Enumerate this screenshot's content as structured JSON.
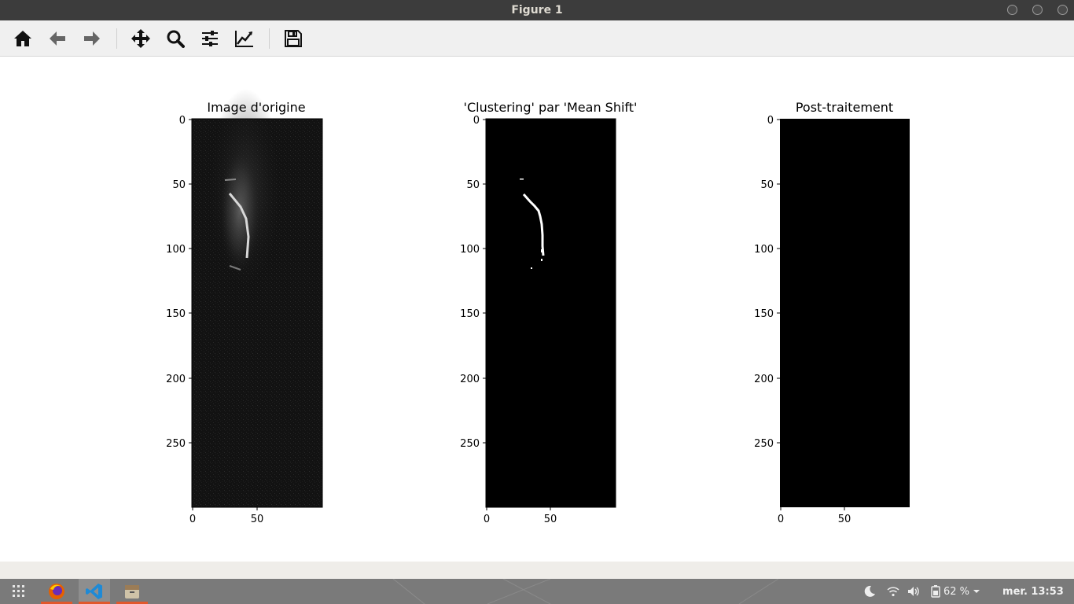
{
  "window": {
    "title": "Figure 1"
  },
  "toolbar": {
    "buttons": [
      {
        "name": "home-button",
        "icon": "home-icon"
      },
      {
        "name": "back-button",
        "icon": "arrow-left-icon"
      },
      {
        "name": "forward-button",
        "icon": "arrow-right-icon"
      },
      {
        "name": "pan-button",
        "icon": "move-icon"
      },
      {
        "name": "zoom-button",
        "icon": "magnifier-icon"
      },
      {
        "name": "configure-subplots-button",
        "icon": "sliders-icon"
      },
      {
        "name": "edit-axes-button",
        "icon": "line-chart-icon"
      },
      {
        "name": "save-button",
        "icon": "floppy-disk-icon"
      }
    ]
  },
  "figure": {
    "panels": [
      {
        "title": "Image d'origine",
        "content": "ultrasound-image"
      },
      {
        "title": "'Clustering' par 'Mean Shift'",
        "content": "binary-mask"
      },
      {
        "title": "Post-traitement",
        "content": "empty-mask"
      }
    ],
    "y_ticks": [
      "0",
      "50",
      "100",
      "150",
      "200",
      "250"
    ],
    "x_ticks": [
      "0",
      "50"
    ]
  },
  "chart_data": [
    {
      "type": "heatmap",
      "title": "Image d'origine",
      "xlim": [
        0,
        100
      ],
      "ylim": [
        300,
        0
      ],
      "xticks": [
        0,
        50
      ],
      "yticks": [
        0,
        50,
        100,
        150,
        200,
        250
      ],
      "colormap": "gray"
    },
    {
      "type": "heatmap",
      "title": "'Clustering' par 'Mean Shift'",
      "xlim": [
        0,
        100
      ],
      "ylim": [
        300,
        0
      ],
      "xticks": [
        0,
        50
      ],
      "yticks": [
        0,
        50,
        100,
        150,
        200,
        250
      ],
      "colormap": "gray"
    },
    {
      "type": "heatmap",
      "title": "Post-traitement",
      "xlim": [
        0,
        100
      ],
      "ylim": [
        300,
        0
      ],
      "xticks": [
        0,
        50
      ],
      "yticks": [
        0,
        50,
        100,
        150,
        200,
        250
      ],
      "colormap": "gray"
    }
  ],
  "taskbar": {
    "apps": [
      {
        "name": "firefox",
        "icon": "firefox-icon"
      },
      {
        "name": "vscode",
        "icon": "vscode-icon"
      },
      {
        "name": "archive",
        "icon": "archive-icon"
      }
    ],
    "tray": {
      "battery": "62 %",
      "clock": "mer. 13:53"
    }
  }
}
